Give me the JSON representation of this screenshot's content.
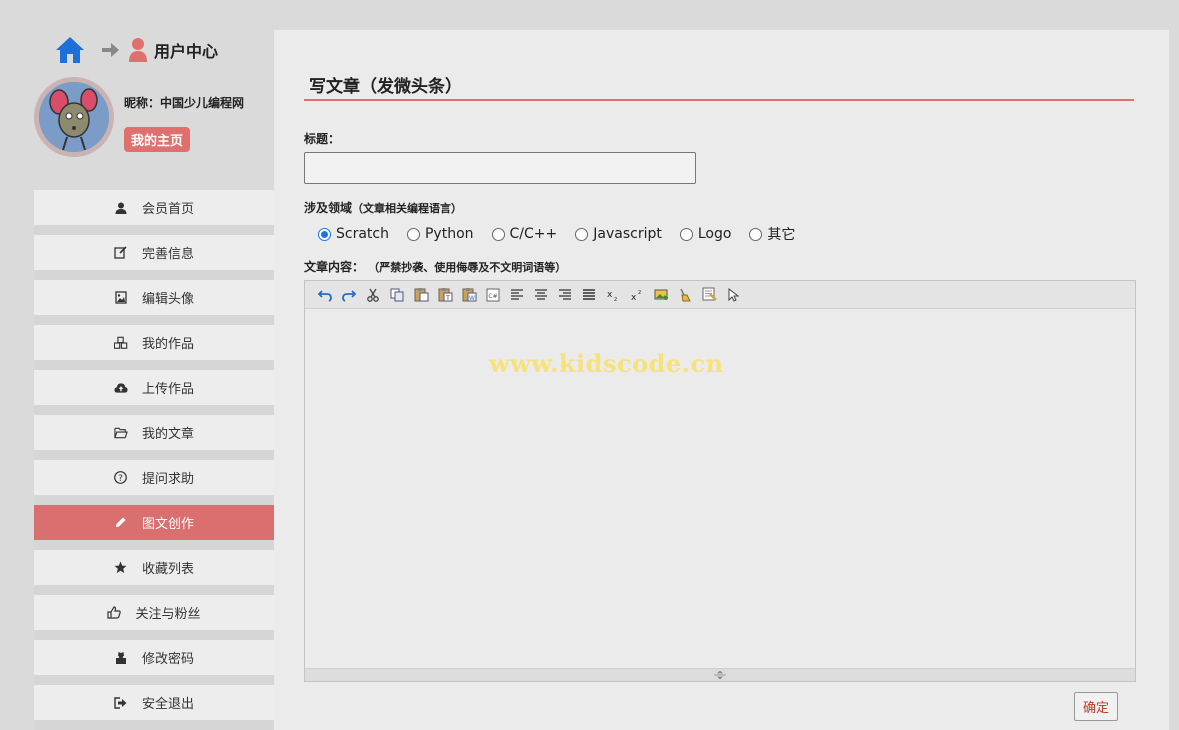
{
  "header": {
    "title": "用户中心"
  },
  "profile": {
    "nickname": "昵称：中国少儿编程网",
    "homepage_label": "我的主页"
  },
  "menu": [
    {
      "label": "会员首页",
      "icon": "user-icon",
      "active": false
    },
    {
      "label": "完善信息",
      "icon": "edit-icon",
      "active": false
    },
    {
      "label": "编辑头像",
      "icon": "image-icon",
      "active": false
    },
    {
      "label": "我的作品",
      "icon": "cubes-icon",
      "active": false
    },
    {
      "label": "上传作品",
      "icon": "cloud-upload-icon",
      "active": false
    },
    {
      "label": "我的文章",
      "icon": "folder-icon",
      "active": false
    },
    {
      "label": "提问求助",
      "icon": "question-icon",
      "active": false
    },
    {
      "label": "图文创作",
      "icon": "pencil-icon",
      "active": true
    },
    {
      "label": "收藏列表",
      "icon": "star-icon",
      "active": false
    },
    {
      "label": "关注与粉丝",
      "icon": "thumbs-up-icon",
      "active": false
    },
    {
      "label": "修改密码",
      "icon": "lock-icon",
      "active": false
    },
    {
      "label": "安全退出",
      "icon": "sign-out-icon",
      "active": false
    }
  ],
  "form": {
    "page_title": "写文章（发微头条）",
    "title_label": "标题：",
    "title_value": "",
    "domain_label": "涉及领域",
    "domain_hint": "（文章相关编程语言）",
    "domains": [
      "Scratch",
      "Python",
      "C/C++",
      "Javascript",
      "Logo",
      "其它"
    ],
    "domain_selected": "Scratch",
    "content_label": "文章内容：",
    "content_hint": "（严禁抄袭、使用侮辱及不文明词语等）",
    "submit_label": "确定"
  },
  "editor": {
    "watermark": "www.kidscode.cn",
    "toolbar": [
      "undo-icon",
      "redo-icon",
      "cut-icon",
      "copy-icon",
      "paste-icon",
      "paste-text-icon",
      "paste-word-icon",
      "code-icon",
      "align-left-icon",
      "align-center-icon",
      "align-right-icon",
      "align-justify-icon",
      "subscript-icon",
      "superscript-icon",
      "insert-image-icon",
      "clear-format-icon",
      "select-all-icon",
      "pointer-icon"
    ]
  },
  "colors": {
    "accent": "#e0706e",
    "active_menu": "#d9706f",
    "radio_checked": "#1a73e8",
    "watermark": "#f5e27a"
  }
}
